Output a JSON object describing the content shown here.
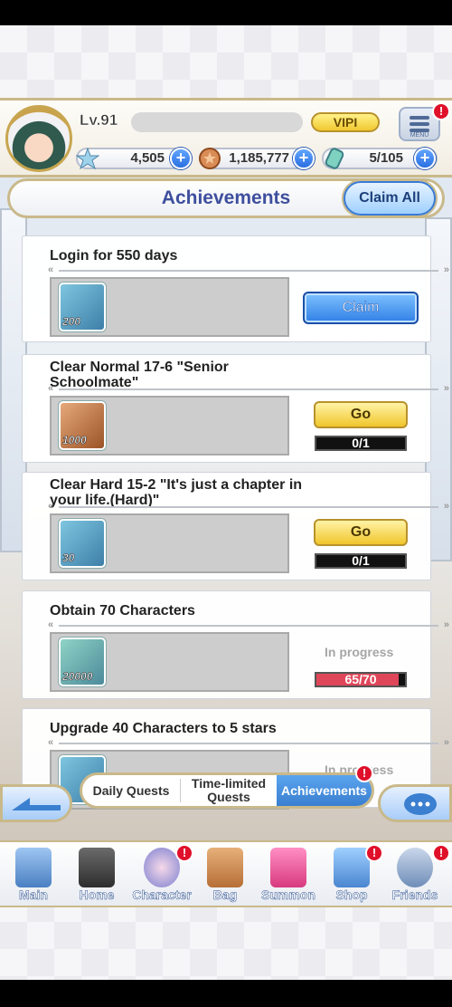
{
  "header": {
    "level": "Lv.91",
    "vip": "VIPI",
    "menu_label": "MENU",
    "gems": "4,505",
    "coins": "1,185,777",
    "stamina": "5/105"
  },
  "title": "Achievements",
  "claim_all": "Claim All",
  "quests": [
    {
      "title": "Login for 550 days",
      "reward_qty": "200",
      "action": "Claim"
    },
    {
      "title": "Clear Normal 17-6 \"Senior Schoolmate\"",
      "reward_qty": "1000",
      "action": "Go",
      "progress": "0/1"
    },
    {
      "title": "Clear Hard 15-2 \"It's just a chapter in your life.(Hard)\"",
      "reward_qty": "30",
      "action": "Go",
      "progress": "0/1"
    },
    {
      "title": "Obtain 70 Characters",
      "reward_qty": "20000",
      "status": "In progress",
      "progress": "65/70",
      "progress_fraction": 0.93
    },
    {
      "title": "Upgrade 40 Characters to 5 stars",
      "status": "In progress"
    }
  ],
  "tabs": [
    "Daily Quests",
    "Time-limited Quests",
    "Achievements"
  ],
  "nav": [
    "Main",
    "Home",
    "Character",
    "Bag",
    "Summon",
    "Shop",
    "Friends"
  ],
  "badge": "!",
  "colors": {
    "accent_blue": "#3e4f9e",
    "gold": "#c9b98a",
    "alert_red": "#e0102a"
  }
}
